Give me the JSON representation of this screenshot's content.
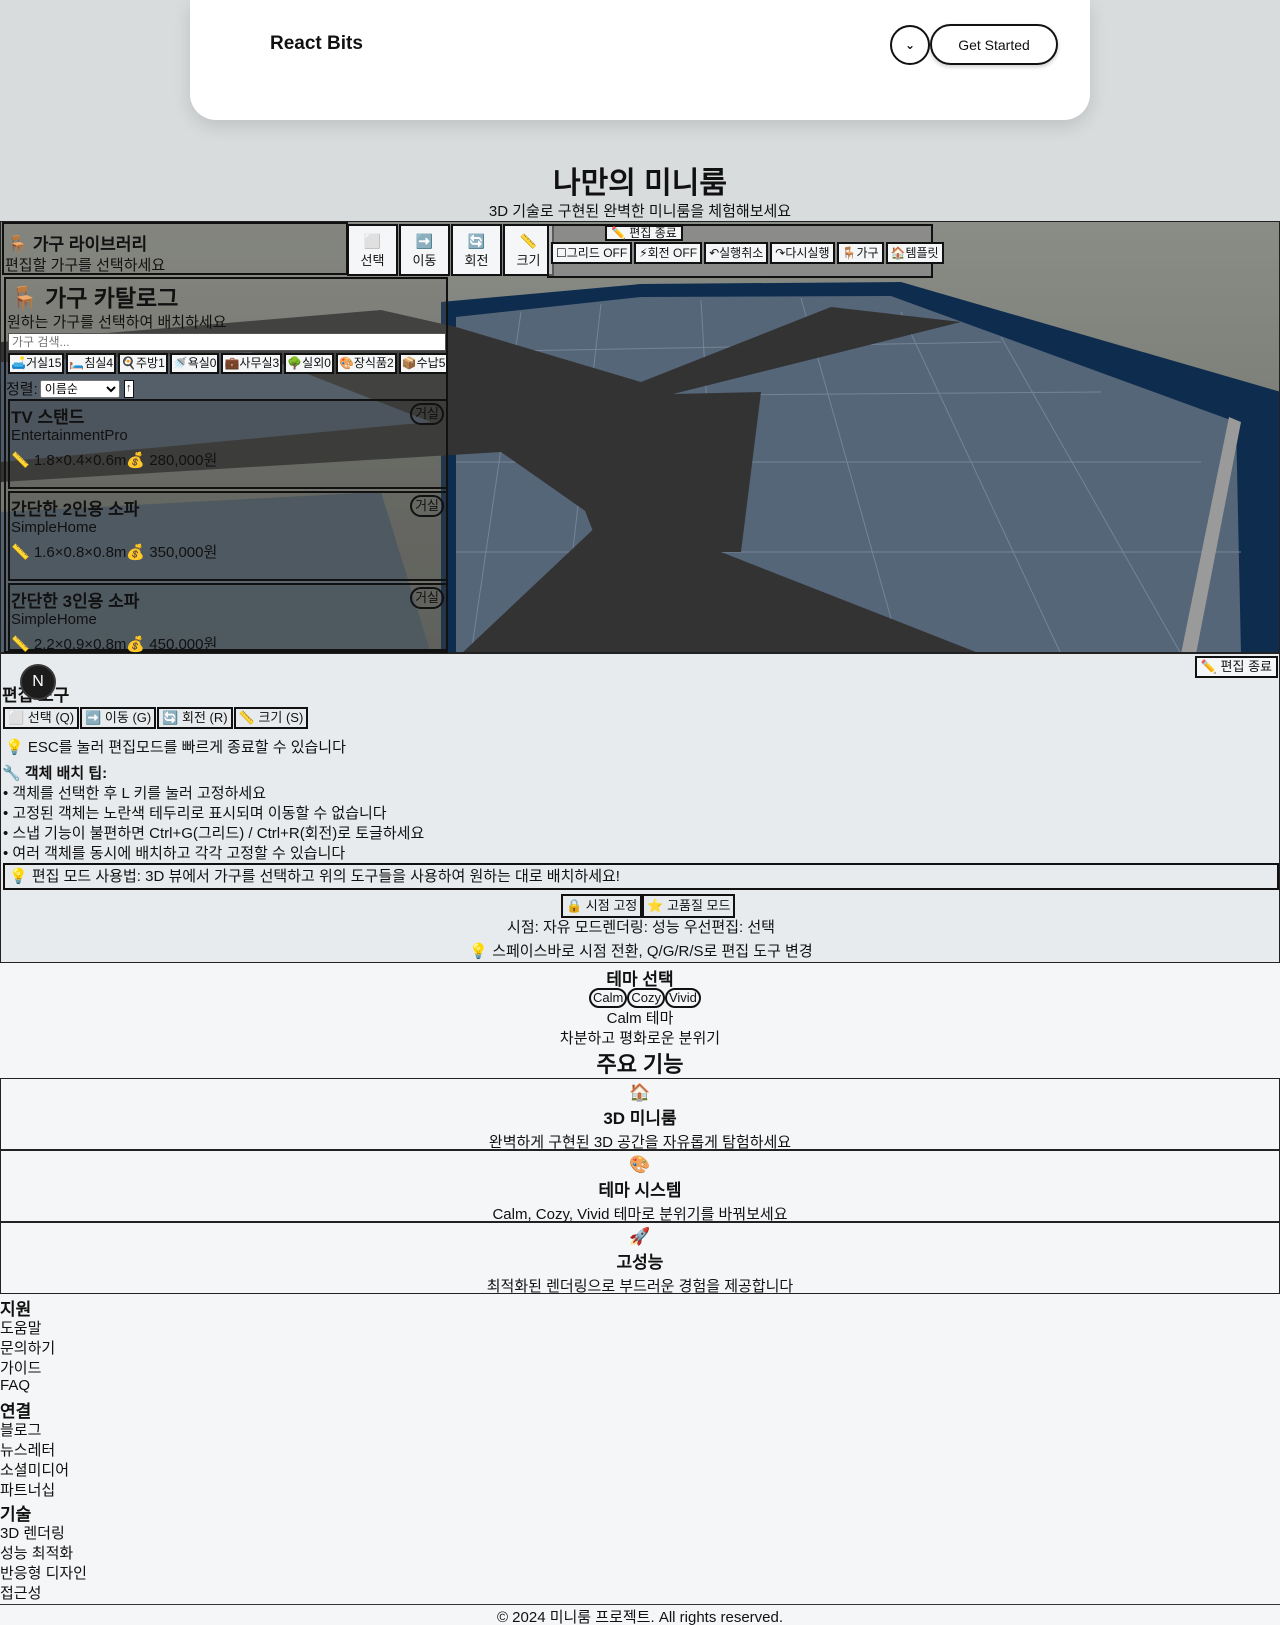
{
  "header": {
    "brand": "React Bits",
    "get_started": "Get Started",
    "menu_icon": "chevron-down-icon"
  },
  "hero": {
    "title": "나만의 미니룸",
    "subtitle": "3D 기술로 구현된 완벽한 미니룸을 체험해보세요"
  },
  "library": {
    "title": "🪑 가구 라이브러리",
    "subtitle": "편집할 가구를 선택하세요"
  },
  "tools": [
    {
      "icon": "⬜",
      "label": "선택"
    },
    {
      "icon": "➡️",
      "label": "이동"
    },
    {
      "icon": "🔄",
      "label": "회전"
    },
    {
      "icon": "📏",
      "label": "크기"
    }
  ],
  "edit_strip": {
    "end_label": "✏️ 편집 종료",
    "chips": [
      "☐그리드 OFF",
      "⚡회전 OFF",
      "↶실행취소",
      "↷다시실행",
      "🪑가구",
      "🏠템플릿"
    ]
  },
  "catalog": {
    "title": "🪑 가구 카탈로그",
    "subtitle": "원하는 가구를 선택하여 배치하세요",
    "search_placeholder": "가구 검색...",
    "categories": [
      "🛋️거실15",
      "🛏️침실4",
      "🍳주방1",
      "🚿욕실0",
      "💼사무실3",
      "🌳실외0",
      "🎨장식품2",
      "📦수납5"
    ],
    "sort_label": "정렬:",
    "sort_value": "이름순",
    "sort_dir": "↑",
    "items": [
      {
        "name": "TV 스탠드",
        "brand": "EntertainmentPro",
        "dims": "📏 1.8×0.4×0.6m💰 280,000원",
        "badge": "거실"
      },
      {
        "name": "간단한 2인용 소파",
        "brand": "SimpleHome",
        "dims": "📏 1.6×0.8×0.8m💰 350,000원",
        "badge": "거실"
      },
      {
        "name": "간단한 3인용 소파",
        "brand": "SimpleHome",
        "dims": "📏 2.2×0.9×0.8m💰 450,000원",
        "badge": "거실"
      }
    ]
  },
  "edit_tools": {
    "end_button": "✏️ 편집 종료",
    "avatar": "N",
    "title": "편집 도구",
    "buttons": [
      "⬜ 선택 (Q)",
      "➡️ 이동 (G)",
      "🔄 회전 (R)",
      "📏 크기 (S)"
    ],
    "esc_hint": "💡 ESC를 눌러 편집모드를 빠르게 종료할 수 있습니다",
    "tip_title": "🔧 객체 배치 팁:",
    "tips": [
      "• 객체를 선택한 후 L 키를 눌러 고정하세요",
      "• 고정된 객체는 노란색 테두리로 표시되며 이동할 수 없습니다",
      "• 스냅 기능이 불편하면 Ctrl+G(그리드) / Ctrl+R(회전)로 토글하세요",
      "• 여러 객체를 동시에 배치하고 각각 고정할 수 있습니다"
    ],
    "usage": "💡 편집 모드 사용법: 3D 뷰에서 가구를 선택하고 위의 도구들을 사용하여 원하는 대로 배치하세요!",
    "mode_buttons": [
      "🔒 시점 고정",
      "⭐ 고품질 모드"
    ],
    "status": "시점: 자유 모드렌더링: 성능 우선편집: 선택",
    "shortcut": "💡 스페이스바로 시점 전환, Q/G/R/S로 편집 도구 변경"
  },
  "theme": {
    "title": "테마 선택",
    "options": [
      "Calm",
      "Cozy",
      "Vivid"
    ],
    "current_name": "Calm 테마",
    "current_desc": "차분하고 평화로운 분위기"
  },
  "features": {
    "title": "주요 기능",
    "items": [
      {
        "icon": "🏠",
        "title": "3D 미니룸",
        "desc": "완벽하게 구현된 3D 공간을 자유롭게 탐험하세요"
      },
      {
        "icon": "🎨",
        "title": "테마 시스템",
        "desc": "Calm, Cozy, Vivid 테마로 분위기를 바꿔보세요"
      },
      {
        "icon": "🚀",
        "title": "고성능",
        "desc": "최적화된 렌더링으로 부드러운 경험을 제공합니다"
      }
    ]
  },
  "footer": {
    "columns": [
      {
        "title": "지원",
        "links": [
          "도움말",
          "문의하기",
          "가이드",
          "FAQ"
        ]
      },
      {
        "title": "연결",
        "links": [
          "블로그",
          "뉴스레터",
          "소셜미디어",
          "파트너십"
        ]
      },
      {
        "title": "기술",
        "links": [
          "3D 렌더링",
          "성능 최적화",
          "반응형 디자인",
          "접근성"
        ]
      }
    ],
    "copyright": "© 2024 미니룸 프로젝트. All rights reserved."
  },
  "colors": {
    "floor_tile": "#4a5a6e",
    "wall": "#0d2a4a",
    "path": "#333333",
    "page_bg": "#d8dcdd"
  }
}
